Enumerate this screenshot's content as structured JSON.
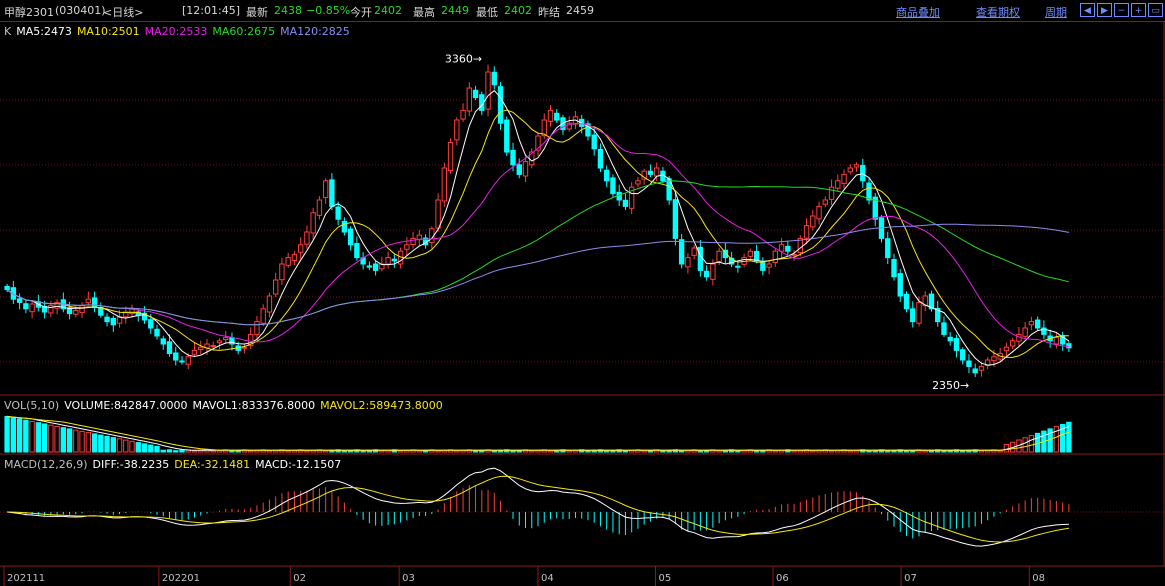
{
  "header": {
    "symbol": "甲醇2301",
    "code": "(030401)",
    "period": "<日线>",
    "time": "[12:01:45]",
    "last_label": "最新",
    "last": "2438",
    "change": "−0.85%",
    "open_label": "今开",
    "open": "2402",
    "high_label": "最高",
    "high": "2449",
    "low_label": "最低",
    "low": "2402",
    "prev_label": "昨结",
    "prev": "2459",
    "links": [
      "商品叠加",
      "查看期权",
      "周期"
    ],
    "nav_icons": [
      "step-left-icon",
      "step-right-icon",
      "zoom-out-icon",
      "zoom-in-icon",
      "window-icon"
    ]
  },
  "ma_legend": [
    {
      "text": "K",
      "color": "#c0c0c0"
    },
    {
      "text": "MA5:2473",
      "color": "#ffffff"
    },
    {
      "text": "MA10:2501",
      "color": "#f5e616"
    },
    {
      "text": "MA20:2533",
      "color": "#e61ee6"
    },
    {
      "text": "MA60:2675",
      "color": "#27d827"
    },
    {
      "text": "MA120:2825",
      "color": "#8c8cf0"
    }
  ],
  "vol_legend": [
    {
      "text": "VOL(5,10)",
      "color": "#c0c0c0"
    },
    {
      "text": "VOLUME:842847.0000",
      "color": "#ffffff"
    },
    {
      "text": "MAVOL1:833376.8000",
      "color": "#ffffff"
    },
    {
      "text": "MAVOL2:589473.8000",
      "color": "#f5e616"
    }
  ],
  "macd_legend": [
    {
      "text": "MACD(12,26,9)",
      "color": "#c0c0c0"
    },
    {
      "text": "DIFF:-38.2235",
      "color": "#ffffff"
    },
    {
      "text": "DEA:-32.1481",
      "color": "#f5e616"
    },
    {
      "text": "MACD:-12.1507",
      "color": "#ffffff"
    }
  ],
  "chart_data": {
    "type": "candlestick",
    "title": "",
    "price_range": [
      2300,
      3400
    ],
    "max_label": "3360",
    "min_label": "2350",
    "x_ticks": [
      "202111",
      "202201",
      "02",
      "03",
      "04",
      "05",
      "06",
      "07",
      "08"
    ],
    "colors": {
      "up": "#ff3c3c",
      "down": "#00ffff",
      "ma5": "#ffffff",
      "ma10": "#f5e616",
      "ma20": "#e61ee6",
      "ma60": "#27d827",
      "ma120": "#8c8cf0",
      "grid": "#7a1010"
    },
    "closes": [
      2620,
      2590,
      2580,
      2560,
      2575,
      2565,
      2550,
      2570,
      2580,
      2560,
      2545,
      2555,
      2570,
      2590,
      2565,
      2540,
      2520,
      2510,
      2535,
      2550,
      2560,
      2540,
      2525,
      2500,
      2475,
      2450,
      2420,
      2400,
      2395,
      2410,
      2430,
      2440,
      2450,
      2445,
      2460,
      2470,
      2450,
      2430,
      2440,
      2480,
      2520,
      2560,
      2600,
      2650,
      2700,
      2720,
      2730,
      2760,
      2800,
      2860,
      2900,
      2960,
      2880,
      2840,
      2800,
      2760,
      2720,
      2700,
      2690,
      2680,
      2700,
      2720,
      2710,
      2740,
      2760,
      2780,
      2790,
      2760,
      2810,
      2900,
      3000,
      3080,
      3150,
      3180,
      3250,
      3220,
      3180,
      3300,
      3260,
      3140,
      3050,
      3010,
      2980,
      3020,
      3050,
      3100,
      3150,
      3180,
      3150,
      3120,
      3140,
      3160,
      3130,
      3100,
      3060,
      3000,
      2960,
      2920,
      2900,
      2880,
      2940,
      2960,
      2990,
      2980,
      3000,
      2960,
      2900,
      2780,
      2700,
      2720,
      2750,
      2680,
      2660,
      2700,
      2740,
      2720,
      2700,
      2690,
      2720,
      2740,
      2710,
      2680,
      2700,
      2740,
      2760,
      2740,
      2730,
      2780,
      2820,
      2850,
      2880,
      2900,
      2940,
      2960,
      2980,
      3000,
      3010,
      2960,
      2900,
      2840,
      2780,
      2720,
      2660,
      2600,
      2560,
      2520,
      2580,
      2600,
      2560,
      2520,
      2480,
      2460,
      2430,
      2400,
      2380,
      2360,
      2380,
      2400,
      2410,
      2420,
      2440,
      2460,
      2480,
      2500,
      2520,
      2500,
      2480,
      2460,
      2470,
      2450,
      2438
    ],
    "volume": {
      "mavol1": 833376.8,
      "mavol2": 589473.8,
      "last": 842847
    },
    "macd": {
      "diff": -38.2235,
      "dea": -32.1481,
      "macd": -12.1507
    }
  }
}
